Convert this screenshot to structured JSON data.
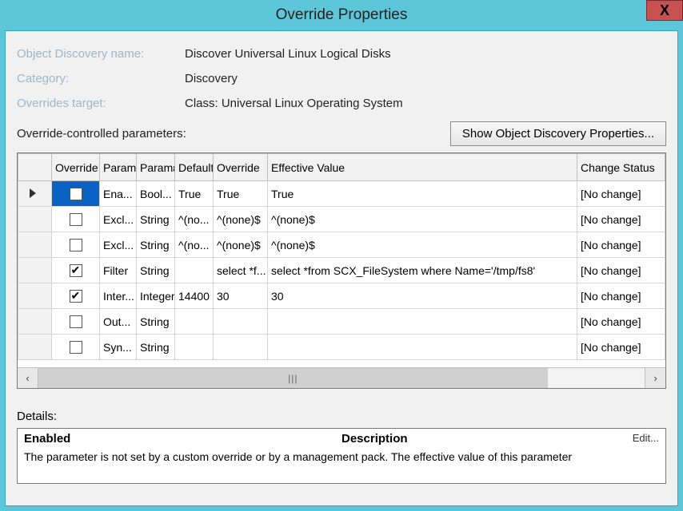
{
  "title": "Override Properties",
  "close_label": "X",
  "meta": {
    "object_discovery_label": "Object Discovery name:",
    "object_discovery_value": "Discover Universal Linux Logical Disks",
    "category_label": "Category:",
    "category_value": "Discovery",
    "target_label": "Overrides target:",
    "target_value": "Class: Universal Linux Operating System"
  },
  "params_label": "Override-controlled parameters:",
  "show_props_btn": "Show Object Discovery Properties...",
  "columns": {
    "override": "Override",
    "param_name": "Paramε",
    "param_type": "Paramε",
    "default_val": "Default",
    "override_val": "Override",
    "effective": "Effective Value",
    "change_status": "Change Status"
  },
  "rows": [
    {
      "pointer": true,
      "selected": true,
      "check": "filled",
      "name": "Ena...",
      "type": "Bool...",
      "def": "True",
      "ov": "True",
      "eff": "True",
      "cs": "[No change]"
    },
    {
      "check": "",
      "name": "Excl...",
      "type": "String",
      "def": "^(no...",
      "ov": "^(none)$",
      "eff": "^(none)$",
      "cs": "[No change]"
    },
    {
      "check": "",
      "name": "Excl...",
      "type": "String",
      "def": "^(no...",
      "ov": "^(none)$",
      "eff": "^(none)$",
      "cs": "[No change]"
    },
    {
      "check": "checked",
      "name": "Filter",
      "type": "String",
      "def": "",
      "ov": "select *f...",
      "eff": "select *from SCX_FileSystem where Name='/tmp/fs8'",
      "cs": "[No change]"
    },
    {
      "check": "checked",
      "name": "Inter...",
      "type": "Integer",
      "def": "14400",
      "ov": "30",
      "eff": "30",
      "cs": "[No change]"
    },
    {
      "check": "",
      "name": "Out...",
      "type": "String",
      "def": "",
      "ov": "",
      "eff": "",
      "cs": "[No change]"
    },
    {
      "check": "",
      "name": "Syn...",
      "type": "String",
      "def": "",
      "ov": "",
      "eff": "",
      "cs": "[No change]"
    }
  ],
  "details_label": "Details:",
  "details": {
    "heading1": "Enabled",
    "heading2": "Description",
    "edit": "Edit...",
    "text": "The parameter is not set by a custom override or by a management pack. The effective value of this parameter"
  }
}
